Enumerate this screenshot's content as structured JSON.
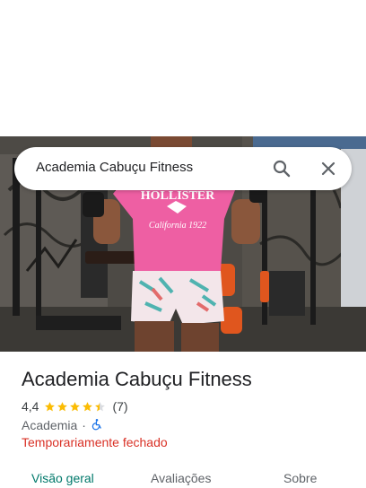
{
  "search": {
    "query": "Academia Cabuçu Fitness",
    "search_icon": "search-icon",
    "close_icon": "close-icon"
  },
  "hero": {
    "shirt_text_1": "HOLLISTER",
    "shirt_text_2": "California 1922"
  },
  "place": {
    "name": "Academia Cabuçu Fitness",
    "rating": "4,4",
    "stars_value": 4.4,
    "review_count": "(7)",
    "category": "Academia",
    "separator": "·",
    "accessibility_icon": "wheelchair-icon",
    "status": "Temporariamente fechado"
  },
  "tabs": [
    {
      "label": "Visão geral",
      "active": true
    },
    {
      "label": "Avaliações",
      "active": false
    },
    {
      "label": "Sobre",
      "active": false
    }
  ],
  "colors": {
    "active_tab": "#00796b",
    "status_closed": "#d93025",
    "star": "#fbbc04"
  }
}
